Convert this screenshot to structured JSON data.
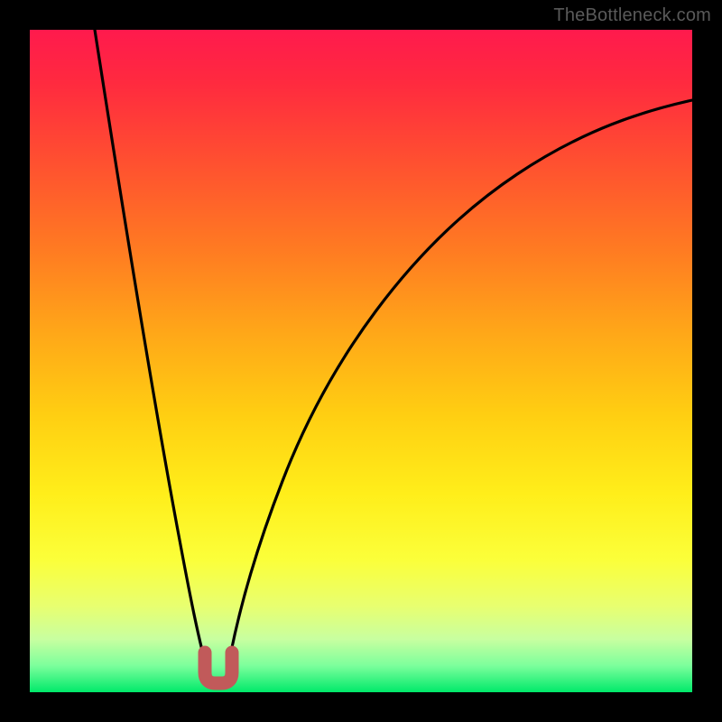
{
  "watermark": "TheBottleneck.com",
  "chart_data": {
    "type": "line",
    "title": "",
    "xlabel": "",
    "ylabel": "",
    "xlim": [
      0,
      100
    ],
    "ylim": [
      0,
      100
    ],
    "series": [
      {
        "name": "bottleneck-curve-left",
        "x": [
          10,
          12,
          14,
          16,
          18,
          20,
          22,
          24,
          25,
          26,
          27,
          28
        ],
        "y": [
          100,
          88,
          75,
          62,
          50,
          38,
          26,
          14,
          8,
          4,
          2,
          2
        ]
      },
      {
        "name": "bottleneck-curve-right",
        "x": [
          28,
          29,
          30,
          32,
          35,
          40,
          45,
          50,
          55,
          60,
          65,
          70,
          75,
          80,
          85,
          90,
          95,
          100
        ],
        "y": [
          2,
          3,
          5,
          10,
          18,
          30,
          40,
          48,
          55,
          61,
          66,
          70,
          74,
          77,
          80,
          82,
          84,
          86
        ]
      },
      {
        "name": "optimal-marker",
        "x": [
          26,
          26.5,
          27,
          27.5,
          28,
          28.5,
          29
        ],
        "y": [
          6,
          3,
          2,
          2,
          2,
          3,
          6
        ]
      }
    ],
    "gradient_stops": [
      {
        "pos": 0,
        "color": "#ff1a4d"
      },
      {
        "pos": 50,
        "color": "#ffc814"
      },
      {
        "pos": 100,
        "color": "#00e96a"
      }
    ]
  }
}
